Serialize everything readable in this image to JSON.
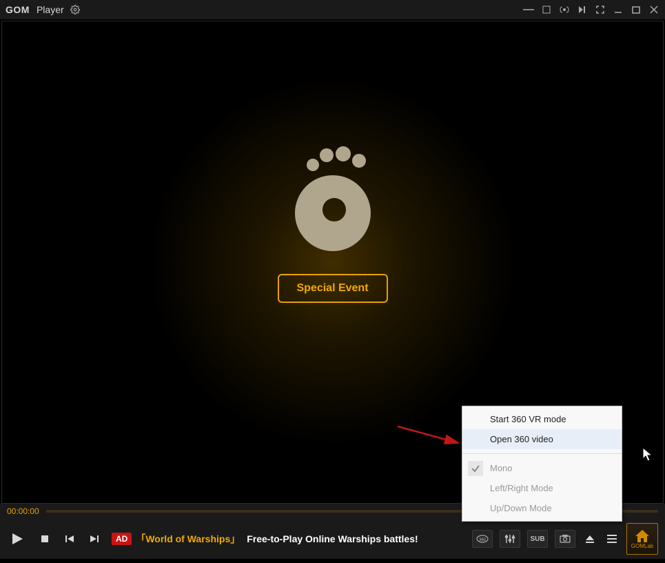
{
  "titlebar": {
    "brandBold": "GOM",
    "brandLight": "Player"
  },
  "video": {
    "specialEventLabel": "Special Event"
  },
  "seek": {
    "currentTime": "00:00:00"
  },
  "ad": {
    "badge": "AD",
    "title": "「World of Warships」",
    "text": "Free-to-Play Online Warships battles!"
  },
  "rightIcons": {
    "threeSixty": "360",
    "equalizer": "EQ",
    "subtitle": "SUB",
    "screenshot": "CAM"
  },
  "home": {
    "label": "GOMLab"
  },
  "contextMenu": {
    "items": [
      {
        "label": "Start 360 VR mode",
        "disabled": false,
        "checked": false
      },
      {
        "label": "Open 360 video",
        "disabled": false,
        "checked": false,
        "highlighted": true
      }
    ],
    "items2": [
      {
        "label": "Mono",
        "disabled": true,
        "checked": true
      },
      {
        "label": "Left/Right Mode",
        "disabled": true,
        "checked": false
      },
      {
        "label": "Up/Down Mode",
        "disabled": true,
        "checked": false
      }
    ]
  }
}
